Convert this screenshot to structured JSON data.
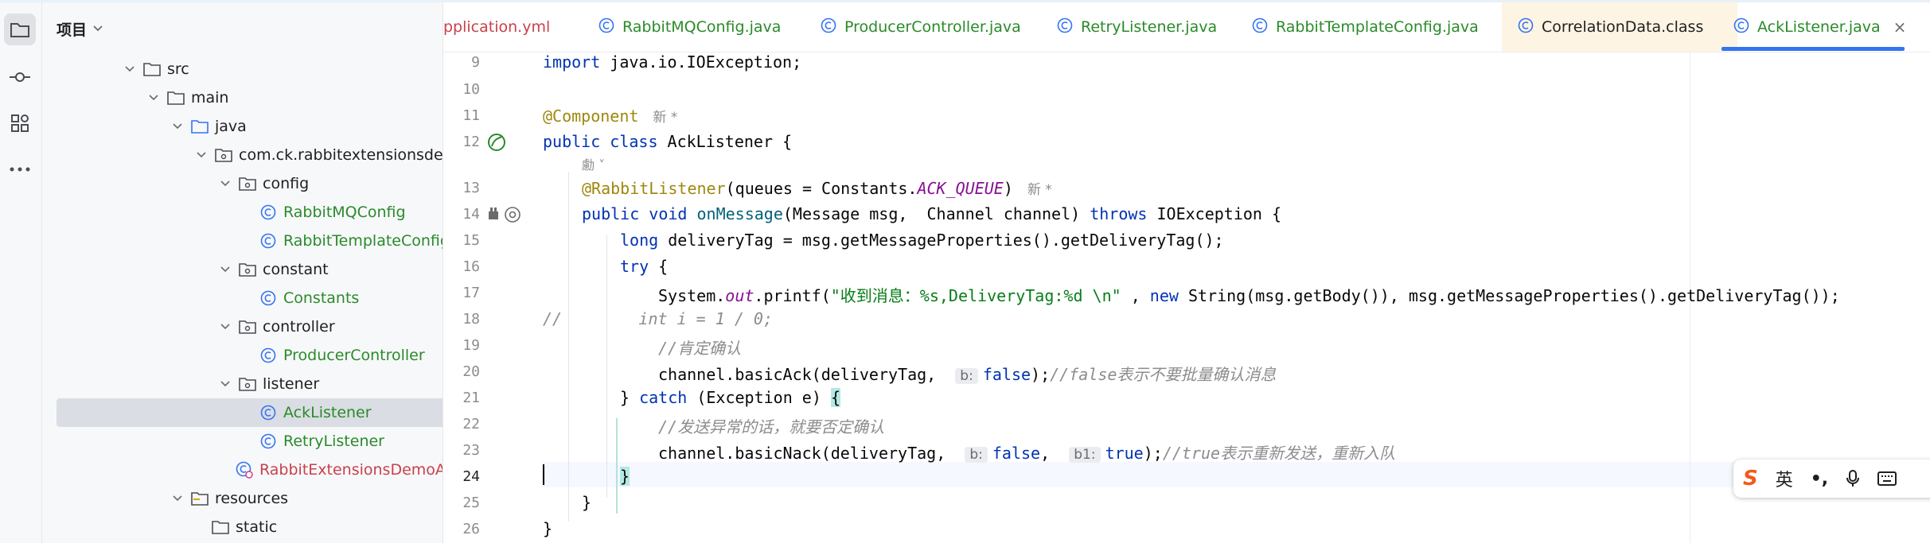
{
  "project_panel": {
    "title": "项目",
    "tree": [
      {
        "label": "src",
        "type": "folder"
      },
      {
        "label": "main",
        "type": "folder"
      },
      {
        "label": "java",
        "type": "source-folder"
      },
      {
        "label": "com.ck.rabbitextensionsdemo",
        "type": "package"
      },
      {
        "label": "config",
        "type": "package"
      },
      {
        "label": "RabbitMQConfig",
        "type": "class"
      },
      {
        "label": "RabbitTemplateConfig",
        "type": "class"
      },
      {
        "label": "constant",
        "type": "package"
      },
      {
        "label": "Constants",
        "type": "class"
      },
      {
        "label": "controller",
        "type": "package"
      },
      {
        "label": "ProducerController",
        "type": "class"
      },
      {
        "label": "listener",
        "type": "package"
      },
      {
        "label": "AckListener",
        "type": "class",
        "selected": true
      },
      {
        "label": "RetryListener",
        "type": "class"
      },
      {
        "label": "RabbitExtensionsDemoApplicati",
        "type": "app-class"
      },
      {
        "label": "resources",
        "type": "resources-folder"
      },
      {
        "label": "static",
        "type": "folder"
      }
    ]
  },
  "tabs": [
    {
      "label": "pplication.yml",
      "color": "#c9414b"
    },
    {
      "label": "RabbitMQConfig.java",
      "color": "#2a8a2a"
    },
    {
      "label": "ProducerController.java",
      "color": "#2a8a2a"
    },
    {
      "label": "RetryListener.java",
      "color": "#2a8a2a"
    },
    {
      "label": "RabbitTemplateConfig.java",
      "color": "#2a8a2a"
    },
    {
      "label": "CorrelationData.class",
      "color": "#1f1f1f"
    },
    {
      "label": "AckListener.java",
      "color": "#2a8a2a",
      "active": true,
      "close": "×"
    }
  ],
  "editor": {
    "line_numbers": [
      "9",
      "10",
      "11",
      "12",
      "13",
      "14",
      "15",
      "16",
      "17",
      "18",
      "19",
      "20",
      "21",
      "22",
      "23",
      "24",
      "25",
      "26"
    ],
    "current_line": "24",
    "l9": {
      "kw": "import",
      "rest": " java.io.IOException;"
    },
    "l11": {
      "ann": "@Component",
      "new": "新 *"
    },
    "l12": {
      "kw1": "public",
      "kw2": "class",
      "rest": " AckListener {"
    },
    "l12_hint": "勴 ˅",
    "l13": {
      "ann": "@RabbitListener",
      "a": "(queues = Constants.",
      "fld": "ACK_QUEUE",
      "b": ")",
      "new": "新 *"
    },
    "l14": {
      "kw1": "public",
      "kw2": "void",
      "mth": "onMessage",
      "a": "(Message msg,  Channel channel) ",
      "kw3": "throws",
      "b": " IOException {"
    },
    "l15": {
      "kw": "long",
      "rest": " deliveryTag = msg.getMessageProperties().getDeliveryTag();"
    },
    "l16": {
      "kw": "try",
      "rest": " {"
    },
    "l17": {
      "a": "System.",
      "fld": "out",
      "b": ".printf(",
      "str": "\"收到消息：%s,DeliveryTag:%d \\n\"",
      "c": " , ",
      "kw": "new",
      "d": " String(msg.getBody()), msg.getMessageProperties().getDeliveryTag());"
    },
    "l18": {
      "cmt": "//        int i = 1 / 0;"
    },
    "l19": {
      "cmt": "//肯定确认"
    },
    "l20": {
      "a": "channel.basicAck(deliveryTag,",
      "hint": "b:",
      "kw": "false",
      "b": ");",
      "cmt": "//false表示不要批量确认消息"
    },
    "l21": {
      "a": "} ",
      "kw": "catch",
      "b": " (Exception e) ",
      "brace": "{"
    },
    "l22": {
      "cmt": "//发送异常的话，就要否定确认"
    },
    "l23": {
      "a": "channel.basicNack(deliveryTag,",
      "hint1": "b:",
      "kw1": "false",
      "c": ",",
      "hint2": "b1:",
      "kw2": "true",
      "b": ");",
      "cmt": "//true表示重新发送，重新入队"
    },
    "l24": {
      "brace": "}"
    },
    "l25": {
      "text": "}"
    },
    "l26": {
      "text": "}"
    }
  },
  "ime_toolbar": {
    "logo": "S",
    "lang": "英",
    "punct": "•,",
    "mic": "mic-icon",
    "keyboard": "keyboard-icon"
  }
}
